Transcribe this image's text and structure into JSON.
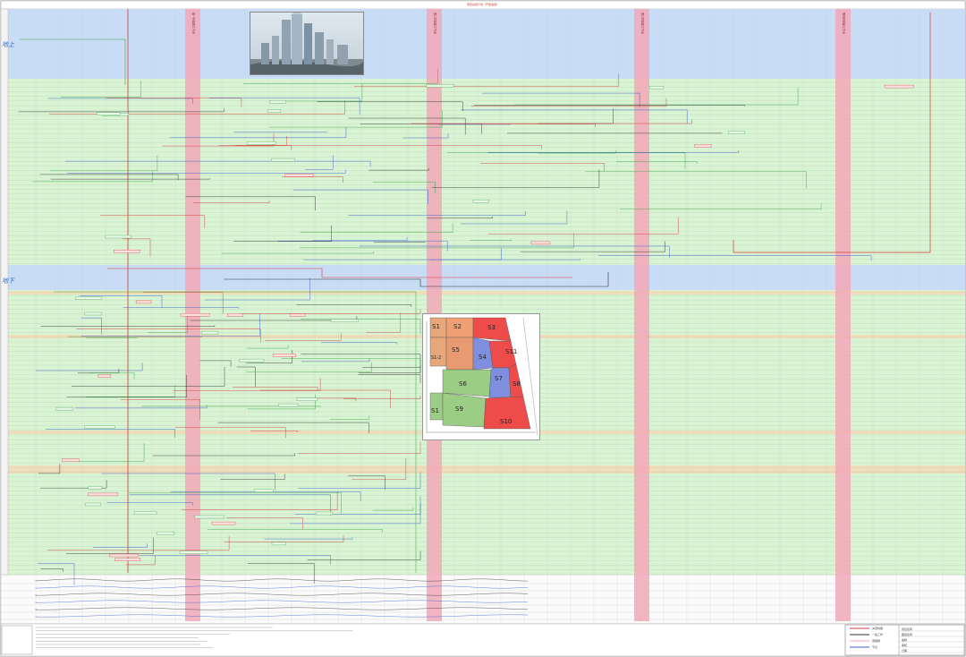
{
  "document": {
    "title": "项目总控计划（开发进度）",
    "band_labels": [
      "地上",
      "地下"
    ]
  },
  "milestone_labels": [
    "第一阶段竣工节点",
    "第二阶段竣工节点",
    "第三阶段竣工节点",
    "第四阶段竣工节点"
  ],
  "zone_map": {
    "zones": [
      {
        "id": "S1",
        "color": "#e7a77a"
      },
      {
        "id": "S2",
        "color": "#ee9f74"
      },
      {
        "id": "S3",
        "color": "#ee4b4b"
      },
      {
        "id": "S4",
        "color": "#7f8fe0"
      },
      {
        "id": "S5",
        "color": "#e89a70"
      },
      {
        "id": "S6",
        "color": "#9ccd85"
      },
      {
        "id": "S7",
        "color": "#7f8fe0"
      },
      {
        "id": "S8",
        "color": "#ee4b4b"
      },
      {
        "id": "S9",
        "color": "#9ccd85"
      },
      {
        "id": "S10",
        "color": "#ee4b4b"
      },
      {
        "id": "S11",
        "color": "#ee4b4b"
      },
      {
        "id": "S1-2",
        "color": "#e7a77a"
      }
    ]
  },
  "colors": {
    "sky_band": "#c9dcf5",
    "green_band": "#d8f4d2",
    "milestone": "#f2a8b8",
    "critical_line": "#d73b3b",
    "green_line": "#3aa64a",
    "blue_line": "#3b5bd6",
    "dark_line": "#333333"
  },
  "legend": {
    "items": [
      "关键线路",
      "一般工作",
      "里程碑",
      "节点"
    ]
  },
  "title_block": {
    "rows": [
      "项目名称",
      "图纸名称",
      "编制",
      "审核",
      "日期"
    ]
  },
  "photo": {
    "name": "tower-rendering"
  }
}
